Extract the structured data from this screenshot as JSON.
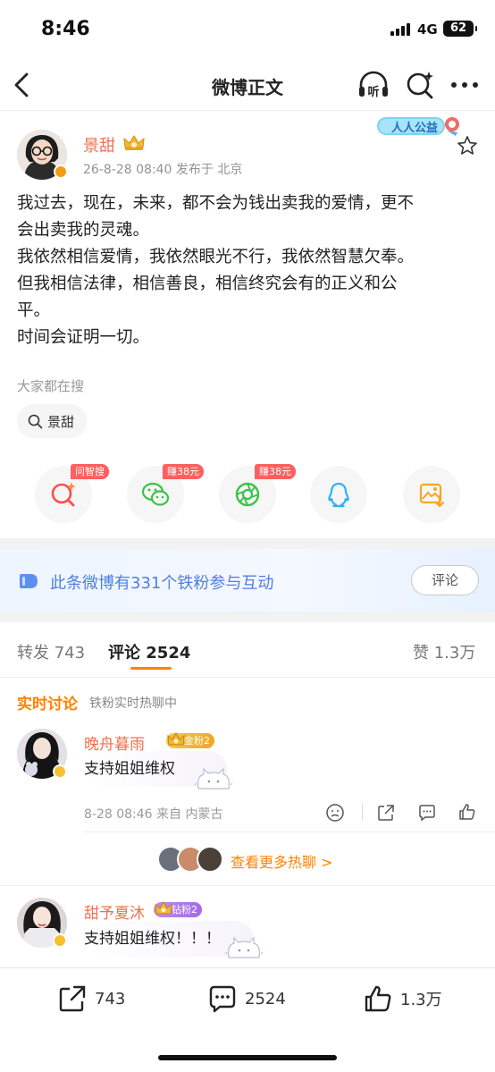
{
  "status_bar": {
    "time": "8:46",
    "network": "4G",
    "battery": "62"
  },
  "nav": {
    "title": "微博正文",
    "listen_label": "听"
  },
  "post": {
    "author": "景甜",
    "meta": "26-8-28 08:40  发布于 北京",
    "charity_label": "人人公益",
    "lines": [
      "我过去，现在，未来，都不会为钱出卖我的爱情，更不",
      "会出卖我的灵魂。",
      "我依然相信爱情，我依然眼光不行，我依然智慧欠奉。",
      "但我相信法律，相信善良，相信终究会有的正义和公",
      "平。",
      "时间会证明一切。"
    ],
    "search_caption": "大家都在搜",
    "search_chip": "景甜"
  },
  "share": [
    {
      "icon": "search-ai-icon",
      "tag": "问智搜"
    },
    {
      "icon": "wechat-icon",
      "tag": "赚38元"
    },
    {
      "icon": "moments-icon",
      "tag": "赚38元"
    },
    {
      "icon": "qq-icon",
      "tag": ""
    },
    {
      "icon": "save-image-icon",
      "tag": ""
    }
  ],
  "fan_banner": {
    "text": "此条微博有331个铁粉参与互动",
    "button": "评论"
  },
  "tabs": {
    "repost": "转发 743",
    "comments": "评论 2524",
    "likes": "赞 1.3万"
  },
  "live": {
    "title": "实时讨论",
    "subtitle": "铁粉实时热聊中"
  },
  "comments": [
    {
      "name": "晚舟暮雨_",
      "badge": "金粉2",
      "text": "支持姐姐维权",
      "meta": "8-28 08:46  来自 内蒙古"
    },
    {
      "name": "甜予夏沐",
      "badge": "钻粉2",
      "text": "支持姐姐维权！！！"
    }
  ],
  "more_hot": "查看更多热聊 >",
  "bottom_bar": {
    "reposts": "743",
    "comments": "2524",
    "likes": "1.3万"
  },
  "colors": {
    "accent": "#ff8200",
    "name": "#eb7350",
    "link_blue": "#4f7fe0"
  }
}
